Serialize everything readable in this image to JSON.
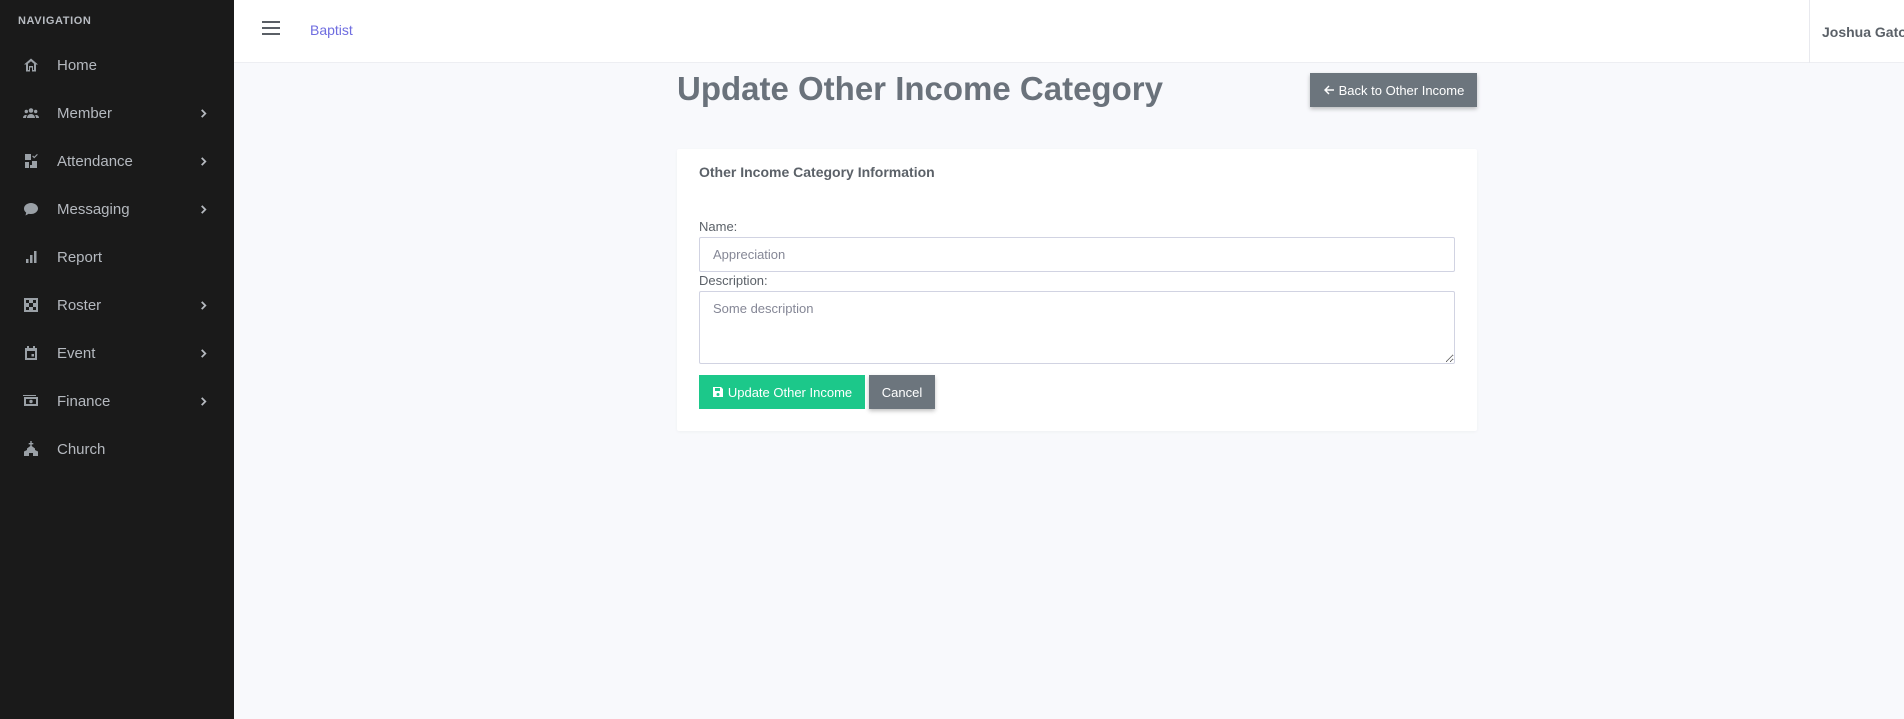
{
  "sidebar": {
    "heading": "NAVIGATION",
    "items": [
      {
        "label": "Home",
        "icon": "home-icon",
        "has_submenu": false
      },
      {
        "label": "Member",
        "icon": "users-icon",
        "has_submenu": true
      },
      {
        "label": "Attendance",
        "icon": "attendance-icon",
        "has_submenu": true
      },
      {
        "label": "Messaging",
        "icon": "message-icon",
        "has_submenu": true
      },
      {
        "label": "Report",
        "icon": "chart-icon",
        "has_submenu": false
      },
      {
        "label": "Roster",
        "icon": "checkerboard-icon",
        "has_submenu": true
      },
      {
        "label": "Event",
        "icon": "calendar-icon",
        "has_submenu": true
      },
      {
        "label": "Finance",
        "icon": "money-icon",
        "has_submenu": true
      },
      {
        "label": "Church",
        "icon": "church-icon",
        "has_submenu": false
      }
    ]
  },
  "topbar": {
    "brand": "Baptist",
    "user_name": "Joshua Gato"
  },
  "page": {
    "title": "Update Other Income Category",
    "back_button": "Back to Other Income"
  },
  "form": {
    "header": "Other Income Category Information",
    "name_label": "Name:",
    "name_placeholder": "Appreciation",
    "description_label": "Description:",
    "description_placeholder": "Some description",
    "update_button": "Update Other Income",
    "cancel_button": "Cancel"
  },
  "colors": {
    "sidebar_bg": "#1a1a1a",
    "brand_link": "#6f6de0",
    "success": "#1cc88a",
    "secondary": "#6c757d",
    "page_bg": "#f8f9fc"
  }
}
